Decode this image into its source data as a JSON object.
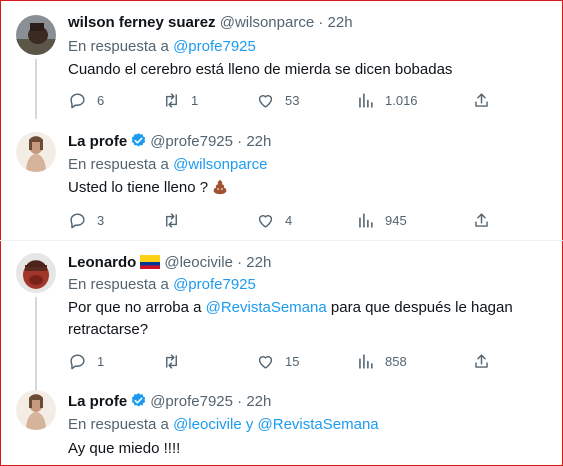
{
  "tweets": [
    {
      "name": "wilson ferney suarez",
      "handle": "@wilsonparce",
      "time": "22h",
      "reply_prefix": "En respuesta a",
      "reply_to": "@profe7925",
      "text": "Cuando el cerebro está lleno de mierda se dicen bobadas",
      "counts": {
        "replies": "6",
        "retweets": "1",
        "likes": "53",
        "views": "1.016"
      }
    },
    {
      "name": "La profe",
      "handle": "@profe7925",
      "time": "22h",
      "verified": true,
      "reply_prefix": "En respuesta a",
      "reply_to": "@wilsonparce",
      "text": "Usted lo tiene lleno ?",
      "emoji": "pile-of-poo",
      "counts": {
        "replies": "3",
        "retweets": "",
        "likes": "4",
        "views": "945"
      }
    },
    {
      "name": "Leonardo",
      "handle": "@leocivile",
      "time": "22h",
      "flag": "colombia-flag",
      "reply_prefix": "En respuesta a",
      "reply_to": "@profe7925",
      "text_pre": "Por que no arroba a ",
      "text_mention": "@RevistaSemana",
      "text_post_line1": " para que después le hagan",
      "text_line2": "retractarse?",
      "counts": {
        "replies": "1",
        "retweets": "",
        "likes": "15",
        "views": "858"
      }
    },
    {
      "name": "La profe",
      "handle": "@profe7925",
      "time": "22h",
      "verified": true,
      "reply_prefix": "En respuesta a",
      "reply_to": "@leocivile",
      "reply_joiner": "y",
      "reply_to_2": "@RevistaSemana",
      "text": "Ay que miedo !!!!"
    }
  ],
  "separator": "·",
  "colors": {
    "link": "#1d9bf0",
    "muted": "#536471",
    "verified": "#1d9bf0",
    "frame": "#d91a1a"
  }
}
